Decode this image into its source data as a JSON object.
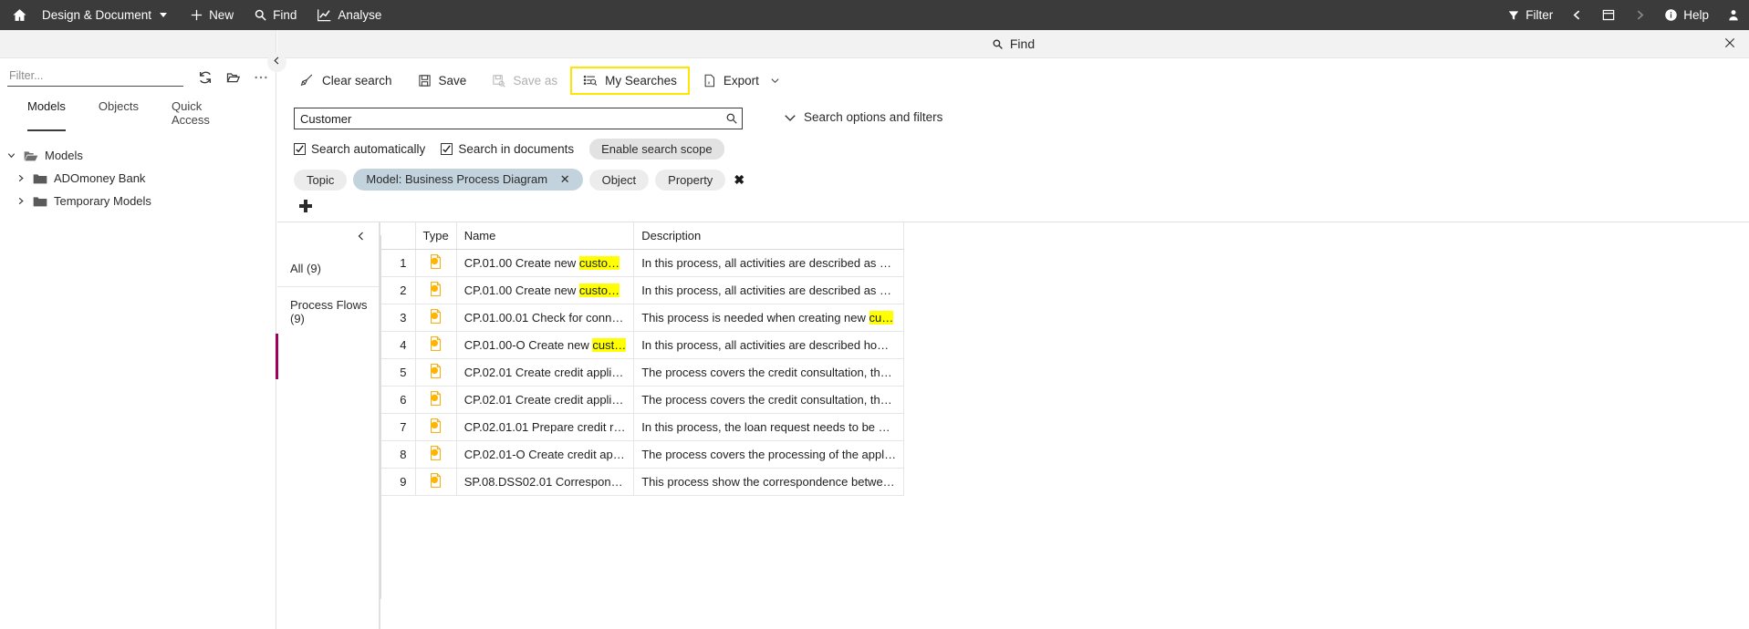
{
  "topbar": {
    "home_icon": "home-icon",
    "app_menu": "Design & Document",
    "new_label": "New",
    "find_label": "Find",
    "analyse_label": "Analyse",
    "filter_label": "Filter",
    "help_label": "Help",
    "prev_icon": "chevron-left-icon",
    "window_icon": "window-icon",
    "next_icon": "chevron-right-icon",
    "user_icon": "user-avatar-icon",
    "bg_color": "#3b3b3b"
  },
  "sidebar": {
    "filter_placeholder": "Filter...",
    "filter_value": "",
    "refresh_icon": "refresh-icon",
    "openfolder_icon": "open-folder-icon",
    "more_icon": "more-options-icon",
    "tabs": [
      {
        "label": "Models",
        "active": true
      },
      {
        "label": "Objects",
        "active": false
      },
      {
        "label": "Quick Access",
        "active": false
      }
    ],
    "tree": [
      {
        "label": "Models",
        "expanded": true,
        "level": 0
      },
      {
        "label": "ADOmoney Bank",
        "expanded": false,
        "level": 1
      },
      {
        "label": "Temporary Models",
        "expanded": false,
        "level": 1
      }
    ],
    "collapse_icon": "chevron-left-icon"
  },
  "find": {
    "header_title": "Find",
    "header_icon": "search-icon",
    "close_icon": "close-icon",
    "toolbar": [
      {
        "label": "Clear search",
        "icon": "broom-icon",
        "disabled": false,
        "highlighted": false
      },
      {
        "label": "Save",
        "icon": "save-icon",
        "disabled": false,
        "highlighted": false
      },
      {
        "label": "Save as",
        "icon": "save-as-icon",
        "disabled": true,
        "highlighted": false
      },
      {
        "label": "My Searches",
        "icon": "my-searches-icon",
        "disabled": false,
        "highlighted": true
      },
      {
        "label": "Export",
        "icon": "export-icon",
        "disabled": false,
        "highlighted": false,
        "has_caret": true
      }
    ],
    "highlight_color": "#ffe600",
    "search_value": "Customer",
    "search_icon": "search-submit-icon",
    "search_options_label": "Search options and filters",
    "search_options_icon": "chevron-down-icon",
    "checkboxes": [
      {
        "label": "Search automatically",
        "checked": true
      },
      {
        "label": "Search in documents",
        "checked": true
      }
    ],
    "scope_button": "Enable search scope",
    "chips": [
      {
        "label": "Topic",
        "selected": false,
        "removable": false
      },
      {
        "label": "Model: Business Process Diagram",
        "selected": true,
        "removable": true
      },
      {
        "label": "Object",
        "selected": false,
        "removable": false
      },
      {
        "label": "Property",
        "selected": false,
        "removable": false
      }
    ],
    "chip_clear_icon": "clear-all-chips-icon",
    "add_criterion_icon": "plus-icon"
  },
  "results": {
    "facet_collapse_icon": "chevron-left-icon",
    "facets": [
      {
        "label": "All (9)",
        "active": true
      },
      {
        "label": "Process Flows (9)",
        "active": false
      }
    ],
    "columns": [
      "",
      "Type",
      "Name",
      "Description"
    ],
    "rows": [
      {
        "num": "1",
        "type_icon": "process-model-icon",
        "name_pre": "CP.01.00 Create new ",
        "name_hl": "custo…",
        "desc": "In this process, all activities are described as …"
      },
      {
        "num": "2",
        "type_icon": "process-model-icon",
        "name_pre": "CP.01.00 Create new ",
        "name_hl": "custo…",
        "desc": "In this process, all activities are described as …"
      },
      {
        "num": "3",
        "type_icon": "process-model-icon",
        "name_pre": "CP.01.00.01 Check for conn…",
        "name_hl": "",
        "desc_pre": "This process is needed when creating new ",
        "desc_hl": "cu…",
        "desc": ""
      },
      {
        "num": "4",
        "type_icon": "process-model-icon",
        "name_pre": "CP.01.00-O Create new ",
        "name_hl": "cust…",
        "desc": "In this process, all activities are described ho…"
      },
      {
        "num": "5",
        "type_icon": "process-model-icon",
        "name_pre": "CP.02.01 Create credit appli…",
        "name_hl": "",
        "desc": "The process covers the credit consultation, th…"
      },
      {
        "num": "6",
        "type_icon": "process-model-icon",
        "name_pre": "CP.02.01 Create credit appli…",
        "name_hl": "",
        "desc": "The process covers the credit consultation, th…"
      },
      {
        "num": "7",
        "type_icon": "process-model-icon",
        "name_pre": "CP.02.01.01 Prepare credit r…",
        "name_hl": "",
        "desc": "In this process, the loan request needs to be …"
      },
      {
        "num": "8",
        "type_icon": "process-model-icon",
        "name_pre": "CP.02.01-O Create credit ap…",
        "name_hl": "",
        "desc": "The process covers the processing of the appl…"
      },
      {
        "num": "9",
        "type_icon": "process-model-icon",
        "name_pre": "SP.08.DSS02.01 Correspon…",
        "name_hl": "",
        "desc": "This process show the correspondence betwe…"
      }
    ]
  }
}
